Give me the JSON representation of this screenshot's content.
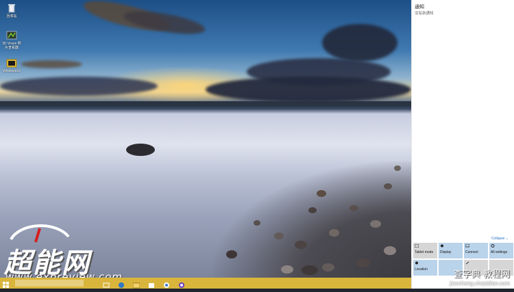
{
  "desktop": {
    "icons": [
      {
        "label": "回收站",
        "icon": "recycle-bin-icon"
      },
      {
        "label": "3D Vision 照片查看器",
        "icon": "3d-vision-icon"
      },
      {
        "label": "Windows10",
        "icon": "folder-icon"
      }
    ]
  },
  "watermark": {
    "logo_text": "超能网",
    "url": "www.expreview.com",
    "corner_text": "查字典 教程网",
    "corner_url": "jiaocheng.chazidian.com"
  },
  "taskbar": {
    "color": "#d9b53b",
    "icons": [
      "start-icon",
      "search-box",
      "task-view-icon",
      "edge-icon",
      "file-explorer-icon",
      "store-icon",
      "app-icon",
      "app-icon-2"
    ]
  },
  "action_center": {
    "title": "通知",
    "subtitle": "没有新通知",
    "collapse_label": "Collapse",
    "tiles": [
      {
        "label": "Tablet mode",
        "icon": "tablet-mode-icon",
        "state": "off"
      },
      {
        "label": "Display",
        "icon": "display-icon",
        "state": "on"
      },
      {
        "label": "Connect",
        "icon": "connect-icon",
        "state": "on"
      },
      {
        "label": "All settings",
        "icon": "settings-icon",
        "state": "on"
      },
      {
        "label": "Location",
        "icon": "location-icon",
        "state": "on"
      },
      {
        "label": "",
        "icon": "tile-icon-6",
        "state": "on"
      },
      {
        "label": "",
        "icon": "tile-icon-7",
        "state": "off"
      },
      {
        "label": "",
        "icon": "tile-icon-8",
        "state": "off"
      }
    ],
    "tile_on_color": "#b9d3ea",
    "tile_off_color": "#d6d6d6"
  }
}
